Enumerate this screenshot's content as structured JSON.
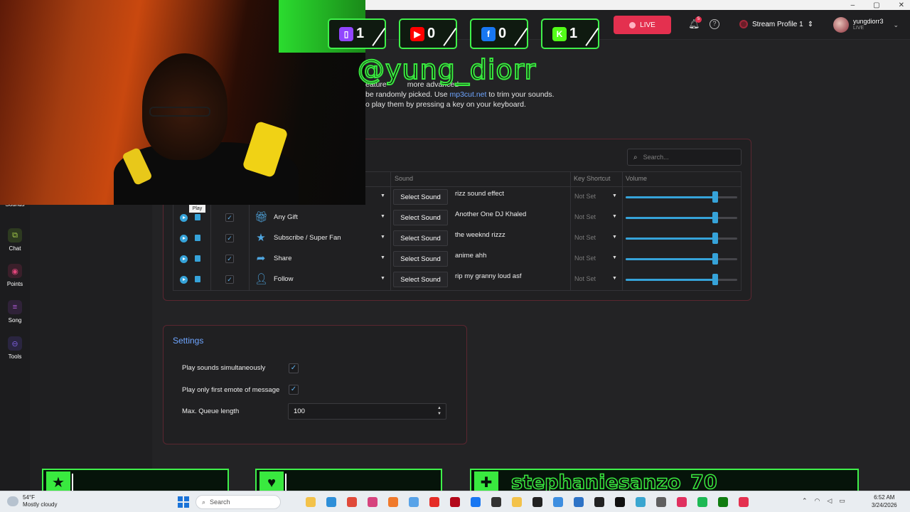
{
  "window_controls": [
    "–",
    "▢",
    "✕"
  ],
  "topbar": {
    "live_label": "LIVE",
    "notification_count": "5",
    "help_symbol": "?",
    "stream_profile": "Stream Profile 1",
    "username": "yungdiorr3",
    "user_status": "LIVE",
    "colors": {
      "live": "#e4304f",
      "accent": "#36a3d9"
    }
  },
  "sidebar": {
    "items": [
      {
        "label": "Sounds",
        "icon": "music-icon",
        "color": "#3ff04a"
      },
      {
        "label": "Chat",
        "icon": "chat-icon",
        "color": "#a3c94a"
      },
      {
        "label": "Points",
        "icon": "points-icon",
        "color": "#e0457a"
      },
      {
        "label": "Song",
        "icon": "song-icon",
        "color": "#b25cd9"
      },
      {
        "label": "Tools",
        "icon": "tools-icon",
        "color": "#7a5cd9"
      }
    ]
  },
  "intro": {
    "line1_a": "eature",
    "line1_b": "more advanced",
    "line2_a": "be randomly picked. Use",
    "line2_link": "mp3cut.net",
    "line2_b": "to trim your sounds.",
    "line3": "o play them by pressing a key on your keyboard."
  },
  "sounds_table": {
    "search_placeholder": "Search...",
    "headers": {
      "sound": "Sound",
      "key": "Key Shortcut",
      "volume": "Volume"
    },
    "tooltip": "Play",
    "select_label": "Select Sound",
    "rows": [
      {
        "trigger": "",
        "icon": "gift-icon",
        "sound": "rizz sound effect",
        "key": "Not Set",
        "volume": 0.8
      },
      {
        "trigger": "Any Gift",
        "icon": "gift-icon",
        "sound": "Another One DJ Khaled",
        "key": "Not Set",
        "volume": 0.8
      },
      {
        "trigger": "Subscribe / Super Fan",
        "icon": "star-icon",
        "sound": "the weeknd rizzz",
        "key": "Not Set",
        "volume": 0.8
      },
      {
        "trigger": "Share",
        "icon": "share-icon",
        "sound": "anime ahh",
        "key": "Not Set",
        "volume": 0.8
      },
      {
        "trigger": "Follow",
        "icon": "follow-icon",
        "sound": "rip my granny loud asf",
        "key": "Not Set",
        "volume": 0.8
      }
    ]
  },
  "settings": {
    "title": "Settings",
    "simultaneous_label": "Play sounds simultaneously",
    "simultaneous_checked": true,
    "first_emote_label": "Play only first emote of message",
    "first_emote_checked": true,
    "queue_label": "Max. Queue length",
    "queue_value": "100"
  },
  "overlay": {
    "badges": [
      {
        "platform": "twitch-icon",
        "count": "1",
        "color": "#9146ff"
      },
      {
        "platform": "youtube-icon",
        "count": "0",
        "color": "#ff0000"
      },
      {
        "platform": "facebook-icon",
        "count": "0",
        "color": "#1877f2"
      },
      {
        "platform": "kick-icon",
        "count": "1",
        "color": "#53fc18"
      }
    ],
    "handle": "@yung_diorr",
    "alert_name": "stephaniesanzo_70"
  },
  "taskbar": {
    "temperature": "54°F",
    "weather": "Mostly cloudy",
    "search": "Search",
    "time": "6:52 AM",
    "date": "3/24/2026"
  }
}
